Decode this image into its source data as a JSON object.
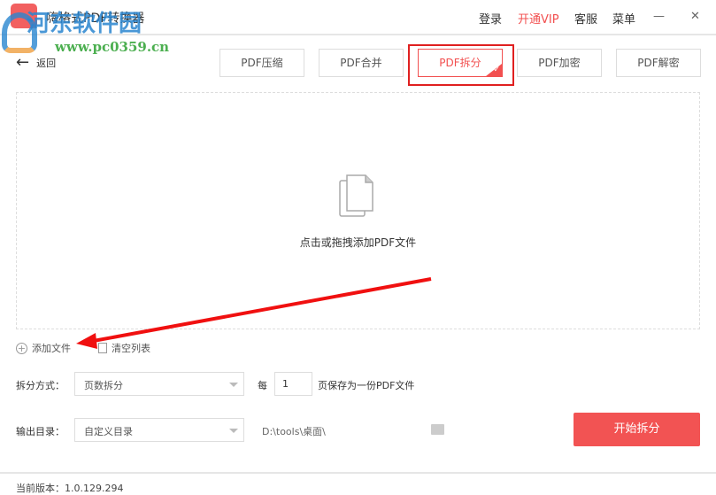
{
  "app": {
    "title": "嗨格式PDF转换器"
  },
  "watermark": {
    "name": "河东软件园",
    "url": "www.pc0359.cn"
  },
  "topnav": {
    "login": "登录",
    "vip": "开通VIP",
    "service": "客服",
    "menu": "菜单"
  },
  "window": {
    "minimize": "—",
    "close": "✕"
  },
  "back": {
    "label": "返回"
  },
  "tabs": [
    {
      "label": "PDF压缩"
    },
    {
      "label": "PDF合并"
    },
    {
      "label": "PDF拆分",
      "active": true
    },
    {
      "label": "PDF加密"
    },
    {
      "label": "PDF解密"
    }
  ],
  "drop": {
    "text": "点击或拖拽添加PDF文件"
  },
  "actions": {
    "add": "添加文件",
    "clear": "清空列表"
  },
  "split": {
    "label": "拆分方式：",
    "value": "页数拆分",
    "per": "每",
    "pages": "1",
    "suffix": "页保存为一份PDF文件"
  },
  "output": {
    "label": "输出目录：",
    "value": "自定义目录",
    "path": "D:\\tools\\桌面\\"
  },
  "start": "开始拆分",
  "footer": {
    "version": "当前版本：1.0.129.294"
  },
  "colors": {
    "accent": "#f25353",
    "annotation": "#e02020"
  }
}
